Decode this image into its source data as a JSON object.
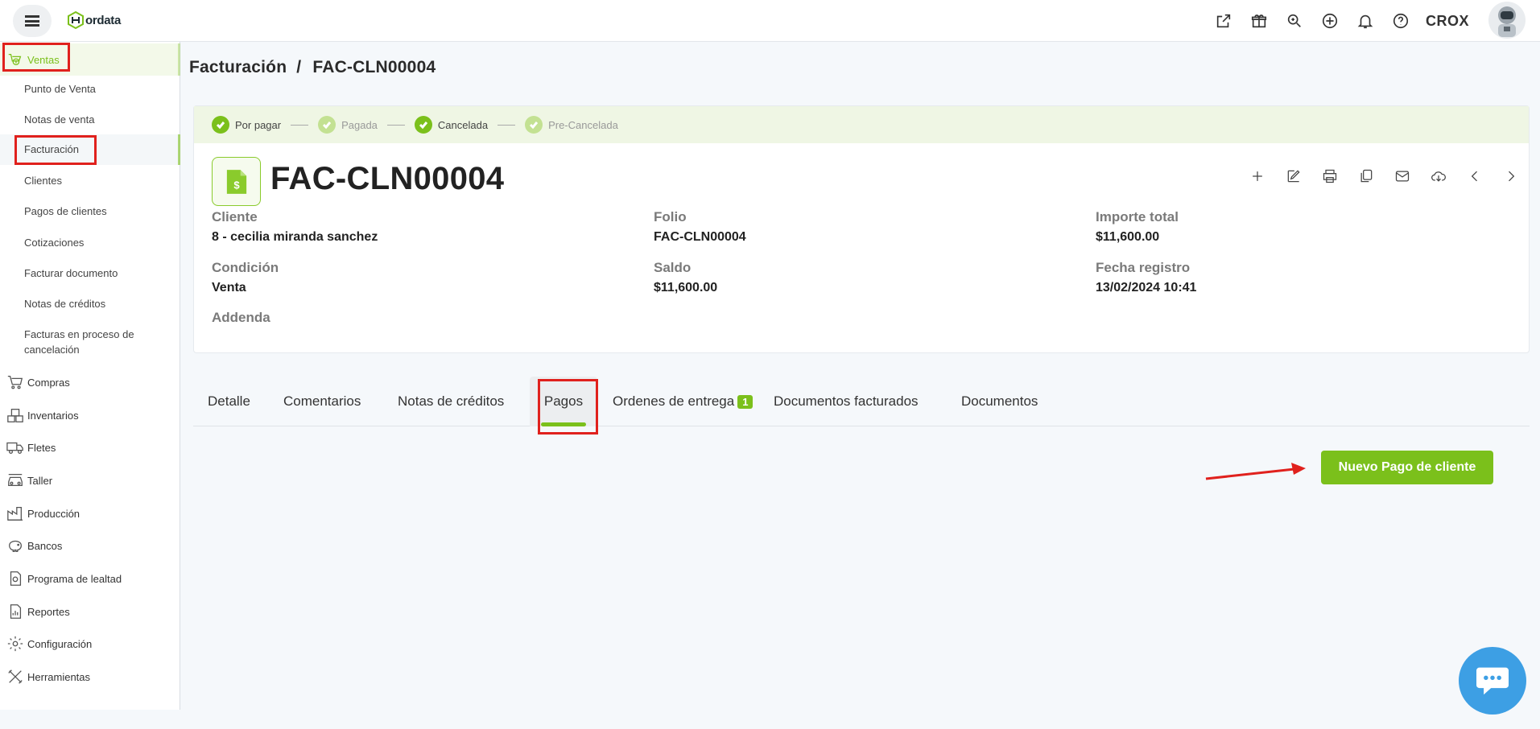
{
  "app": {
    "logo_text": "ordata",
    "user_name": "CROX"
  },
  "sidebar": {
    "ventas": "Ventas",
    "sub_items": [
      "Punto de Venta",
      "Notas de venta",
      "Facturación",
      "Clientes",
      "Pagos de clientes",
      "Cotizaciones",
      "Facturar documento",
      "Notas de créditos",
      "Facturas en proceso de cancelación"
    ],
    "sections": [
      "Compras",
      "Inventarios",
      "Fletes",
      "Taller",
      "Producción",
      "Bancos",
      "Programa de lealtad",
      "Reportes",
      "Configuración",
      "Herramientas"
    ]
  },
  "breadcrumb": {
    "parent": "Facturación",
    "separator": "/",
    "current": "FAC-CLN00004"
  },
  "status_steps": [
    {
      "label": "Por pagar",
      "state": "active"
    },
    {
      "label": "Pagada",
      "state": "dim"
    },
    {
      "label": "Cancelada",
      "state": "active"
    },
    {
      "label": "Pre-Cancelada",
      "state": "dim"
    }
  ],
  "document": {
    "title": "FAC-CLN00004",
    "fields": {
      "cliente_label": "Cliente",
      "cliente_value": "8 - cecilia miranda sanchez",
      "folio_label": "Folio",
      "folio_value": "FAC-CLN00004",
      "importe_label": "Importe total",
      "importe_value": "$11,600.00",
      "condicion_label": "Condición",
      "condicion_value": "Venta",
      "saldo_label": "Saldo",
      "saldo_value": "$11,600.00",
      "fecha_label": "Fecha registro",
      "fecha_value": "13/02/2024 10:41",
      "addenda_label": "Addenda"
    }
  },
  "tabs": [
    {
      "label": "Detalle"
    },
    {
      "label": "Comentarios"
    },
    {
      "label": "Notas de créditos"
    },
    {
      "label": "Pagos",
      "active": true
    },
    {
      "label": "Ordenes de entrega",
      "badge": "1"
    },
    {
      "label": "Documentos facturados"
    },
    {
      "label": "Documentos"
    }
  ],
  "buttons": {
    "new_payment": "Nuevo Pago de cliente"
  },
  "colors": {
    "accent": "#7bc01b",
    "highlight": "#e0211d",
    "chat": "#3d9fe4"
  }
}
